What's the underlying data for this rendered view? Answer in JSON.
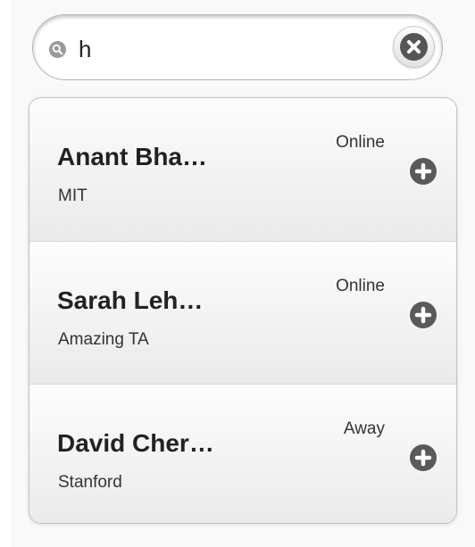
{
  "search": {
    "value": "h",
    "icon": "search-icon",
    "clear_icon": "close-icon"
  },
  "contacts": [
    {
      "name": "Anant Bha…",
      "subtitle": "MIT",
      "status": "Online",
      "action_icon": "plus-icon"
    },
    {
      "name": "Sarah Leh…",
      "subtitle": "Amazing TA",
      "status": "Online",
      "action_icon": "plus-icon"
    },
    {
      "name": "David Cher…",
      "subtitle": "Stanford",
      "status": "Away",
      "action_icon": "plus-icon"
    }
  ],
  "colors": {
    "icon_dark": "#555555",
    "search_icon": "#9a9a9a",
    "text": "#222222"
  }
}
